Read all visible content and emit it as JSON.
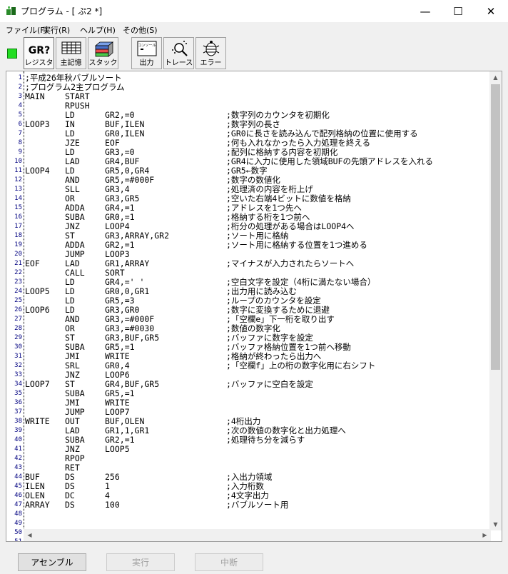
{
  "window": {
    "title": "プログラム - [ ぷ2 *]",
    "minimize_glyph": "—",
    "maximize_glyph": "☐",
    "close_glyph": "✕"
  },
  "menu": [
    {
      "label": "ファイル(F)"
    },
    {
      "label": "実行(R)"
    },
    {
      "label": "ヘルプ(H)"
    },
    {
      "label": "その他(S)"
    }
  ],
  "toolbar": {
    "register": {
      "label": "レジスタ",
      "icon_text": "GR?"
    },
    "memory": {
      "label": "主記憶"
    },
    "stack": {
      "label": "スタック"
    },
    "output": {
      "label": "出力",
      "icon_text": "コンソール"
    },
    "trace": {
      "label": "トレース"
    },
    "error": {
      "label": "エラー"
    }
  },
  "code": [
    {
      "n": "1",
      "label": ";平成26年秋バブルソート",
      "op": "",
      "arg": "",
      "cmt": ""
    },
    {
      "n": "2",
      "label": ";プログラム2主プログラム",
      "op": "",
      "arg": "",
      "cmt": ""
    },
    {
      "n": "3",
      "label": "MAIN",
      "op": "START",
      "arg": "",
      "cmt": ""
    },
    {
      "n": "4",
      "label": "",
      "op": "RPUSH",
      "arg": "",
      "cmt": ""
    },
    {
      "n": "5",
      "label": "",
      "op": "LD",
      "arg": "GR2,=0",
      "cmt": ";数字列のカウンタを初期化"
    },
    {
      "n": "6",
      "label": "LOOP3",
      "op": "IN",
      "arg": "BUF,ILEN",
      "cmt": ";数字列の長さ"
    },
    {
      "n": "7",
      "label": "",
      "op": "LD",
      "arg": "GR0,ILEN",
      "cmt": ";GR0に長さを読み込んで配列格納の位置に使用する"
    },
    {
      "n": "8",
      "label": "",
      "op": "JZE",
      "arg": "EOF",
      "cmt": ";何も入れなかったら入力処理を終える"
    },
    {
      "n": "9",
      "label": "",
      "op": "LD",
      "arg": "GR3,=0",
      "cmt": ";配列に格納する内容を初期化"
    },
    {
      "n": "10",
      "label": "",
      "op": "LAD",
      "arg": "GR4,BUF",
      "cmt": ";GR4に入力に使用した領域BUFの先頭アドレスを入れる"
    },
    {
      "n": "11",
      "label": "LOOP4",
      "op": "LD",
      "arg": "GR5,0,GR4",
      "cmt": ";GR5←数字"
    },
    {
      "n": "12",
      "label": "",
      "op": "AND",
      "arg": "GR5,=#000F",
      "cmt": ";数字の数値化"
    },
    {
      "n": "13",
      "label": "",
      "op": "SLL",
      "arg": "GR3,4",
      "cmt": ";処理済の内容を桁上げ"
    },
    {
      "n": "14",
      "label": "",
      "op": "OR",
      "arg": "GR3,GR5",
      "cmt": ";空いた右端4ビットに数値を格納"
    },
    {
      "n": "15",
      "label": "",
      "op": "ADDA",
      "arg": "GR4,=1",
      "cmt": ";アドレスを1つ先へ"
    },
    {
      "n": "16",
      "label": "",
      "op": "SUBA",
      "arg": "GR0,=1",
      "cmt": ";格納する桁を1つ前へ"
    },
    {
      "n": "17",
      "label": "",
      "op": "JNZ",
      "arg": "LOOP4",
      "cmt": ";桁分の処理がある場合はLOOP4へ"
    },
    {
      "n": "18",
      "label": "",
      "op": "ST",
      "arg": "GR3,ARRAY,GR2",
      "cmt": ";ソート用に格納"
    },
    {
      "n": "19",
      "label": "",
      "op": "ADDA",
      "arg": "GR2,=1",
      "cmt": ";ソート用に格納する位置を1つ進める"
    },
    {
      "n": "20",
      "label": "",
      "op": "JUMP",
      "arg": "LOOP3",
      "cmt": ""
    },
    {
      "n": "21",
      "label": "EOF",
      "op": "LAD",
      "arg": "GR1,ARRAY",
      "cmt": ";マイナスが入力されたらソートへ"
    },
    {
      "n": "22",
      "label": "",
      "op": "CALL",
      "arg": "SORT",
      "cmt": ""
    },
    {
      "n": "23",
      "label": "",
      "op": "LD",
      "arg": "GR4,=' '",
      "cmt": ";空白文字を設定（4桁に満たない場合）"
    },
    {
      "n": "24",
      "label": "LOOP5",
      "op": "LD",
      "arg": "GR0,0,GR1",
      "cmt": ";出力用に読み込む"
    },
    {
      "n": "25",
      "label": "",
      "op": "LD",
      "arg": "GR5,=3",
      "cmt": ";ループのカウンタを設定"
    },
    {
      "n": "26",
      "label": "LOOP6",
      "op": "LD",
      "arg": "GR3,GR0",
      "cmt": ";数字に変換するために退避"
    },
    {
      "n": "27",
      "label": "",
      "op": "AND",
      "arg": "GR3,=#000F",
      "cmt": ";「空欄e」下一桁を取り出す"
    },
    {
      "n": "28",
      "label": "",
      "op": "OR",
      "arg": "GR3,=#0030",
      "cmt": ";数値の数字化"
    },
    {
      "n": "29",
      "label": "",
      "op": "ST",
      "arg": "GR3,BUF,GR5",
      "cmt": ";バッファに数字を設定"
    },
    {
      "n": "30",
      "label": "",
      "op": "SUBA",
      "arg": "GR5,=1",
      "cmt": ";バッファ格納位置を1つ前へ移動"
    },
    {
      "n": "31",
      "label": "",
      "op": "JMI",
      "arg": "WRITE",
      "cmt": ";格納が終わったら出力へ"
    },
    {
      "n": "32",
      "label": "",
      "op": "SRL",
      "arg": "GR0,4",
      "cmt": ";「空欄f」上の桁の数字化用に右シフト"
    },
    {
      "n": "33",
      "label": "",
      "op": "JNZ",
      "arg": "LOOP6",
      "cmt": ""
    },
    {
      "n": "34",
      "label": "LOOP7",
      "op": "ST",
      "arg": "GR4,BUF,GR5",
      "cmt": ";バッファに空白を設定"
    },
    {
      "n": "35",
      "label": "",
      "op": "SUBA",
      "arg": "GR5,=1",
      "cmt": ""
    },
    {
      "n": "36",
      "label": "",
      "op": "JMI",
      "arg": "WRITE",
      "cmt": ""
    },
    {
      "n": "37",
      "label": "",
      "op": "JUMP",
      "arg": "LOOP7",
      "cmt": ""
    },
    {
      "n": "38",
      "label": "WRITE",
      "op": "OUT",
      "arg": "BUF,OLEN",
      "cmt": ";4桁出力"
    },
    {
      "n": "39",
      "label": "",
      "op": "LAD",
      "arg": "GR1,1,GR1",
      "cmt": ";次の数値の数字化と出力処理へ"
    },
    {
      "n": "40",
      "label": "",
      "op": "SUBA",
      "arg": "GR2,=1",
      "cmt": ";処理待ち分を減らす"
    },
    {
      "n": "41",
      "label": "",
      "op": "JNZ",
      "arg": "LOOP5",
      "cmt": ""
    },
    {
      "n": "42",
      "label": "",
      "op": "RPOP",
      "arg": "",
      "cmt": ""
    },
    {
      "n": "43",
      "label": "",
      "op": "RET",
      "arg": "",
      "cmt": ""
    },
    {
      "n": "44",
      "label": "BUF",
      "op": "DS",
      "arg": "256",
      "cmt": ";入出力領域"
    },
    {
      "n": "45",
      "label": "ILEN",
      "op": "DS",
      "arg": "1",
      "cmt": ";入力桁数"
    },
    {
      "n": "46",
      "label": "OLEN",
      "op": "DC",
      "arg": "4",
      "cmt": ";4文字出力"
    },
    {
      "n": "47",
      "label": "ARRAY",
      "op": "DS",
      "arg": "100",
      "cmt": ";バブルソート用"
    },
    {
      "n": "48",
      "label": "",
      "op": "",
      "arg": "",
      "cmt": ""
    },
    {
      "n": "49",
      "label": "",
      "op": "",
      "arg": "",
      "cmt": ""
    },
    {
      "n": "50",
      "label": "",
      "op": "",
      "arg": "",
      "cmt": ""
    },
    {
      "n": "51",
      "label": "",
      "op": "",
      "arg": "",
      "cmt": ""
    }
  ],
  "buttons": {
    "assemble": "アセンブル",
    "run": "実行",
    "abort": "中断"
  },
  "colors": {
    "led": "#22dd22",
    "line_numbers": "#000080"
  }
}
